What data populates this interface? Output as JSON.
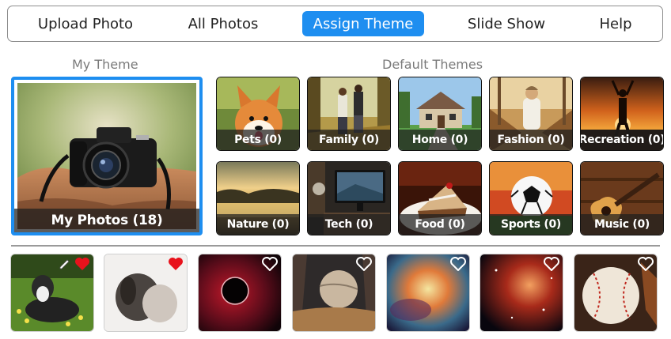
{
  "nav": {
    "items": [
      {
        "label": "Upload Photo",
        "active": false
      },
      {
        "label": "All Photos",
        "active": false
      },
      {
        "label": "Assign Theme",
        "active": true
      },
      {
        "label": "Slide Show",
        "active": false
      },
      {
        "label": "Help",
        "active": false
      }
    ],
    "accent": "#1e8ef0"
  },
  "my_theme": {
    "heading": "My Theme",
    "caption": "My Photos (18)",
    "selected": true
  },
  "default_themes": {
    "heading": "Default Themes",
    "tiles": [
      {
        "caption": "Pets (0)"
      },
      {
        "caption": "Family (0)"
      },
      {
        "caption": "Home (0)"
      },
      {
        "caption": "Fashion (0)"
      },
      {
        "caption": "Recreation (0)"
      },
      {
        "caption": "Nature (0)"
      },
      {
        "caption": "Tech (0)"
      },
      {
        "caption": "Food (0)"
      },
      {
        "caption": "Sports (0)"
      },
      {
        "caption": "Music (0)"
      }
    ]
  },
  "photo_strip": {
    "photos": [
      {
        "subject": "dog-in-flowers",
        "favorited": true,
        "editable": true
      },
      {
        "subject": "dog-and-person-bw",
        "favorited": true,
        "editable": false
      },
      {
        "subject": "space-black-hole",
        "favorited": false,
        "editable": false
      },
      {
        "subject": "alien-planet-landscape",
        "favorited": false,
        "editable": false
      },
      {
        "subject": "nebula",
        "favorited": false,
        "editable": false
      },
      {
        "subject": "galaxy-stars",
        "favorited": false,
        "editable": false
      },
      {
        "subject": "baseball",
        "favorited": false,
        "editable": false
      }
    ],
    "icons": {
      "favorite": "heart-icon",
      "edit": "pencil-icon"
    },
    "favorite_color": "#e8121c"
  }
}
